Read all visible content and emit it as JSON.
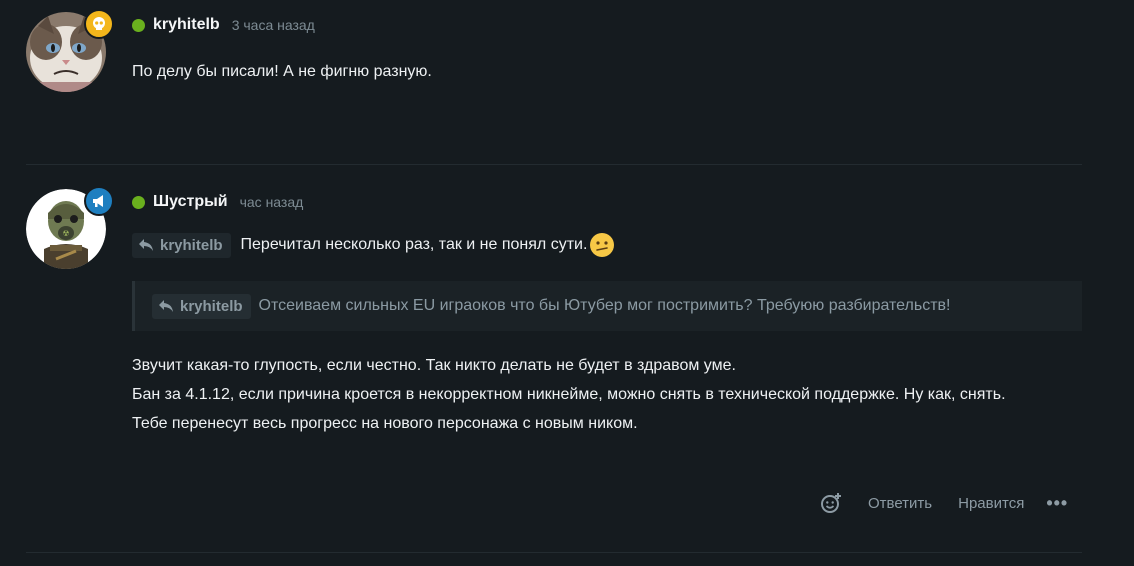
{
  "comments": [
    {
      "author": "kryhitelb",
      "time": "3 часа назад",
      "badge_icon": "skull-icon",
      "text": "По делу бы писали! А не фигню разную."
    },
    {
      "author": "Шустрый",
      "time": "час назад",
      "badge_icon": "megaphone-icon",
      "reply_to": "kryhitelb",
      "reply_text": "Перечитал несколько раз, так и не понял сути.",
      "quote": {
        "author": "kryhitelb",
        "text": "Отсеиваем сильных EU играоков что бы Ютубер мог постримить? Требуюю разбирательств!"
      },
      "body_lines": [
        "Звучит какая-то глупость, если честно. Так никто делать не будет в здравом уме.",
        "Бан за 4.1.12, если причина кроется в некорректном никнейме, можно снять в технической поддержке. Ну как, снять.",
        "Тебе перенесут весь прогресс на нового персонажа с новым ником."
      ],
      "actions": {
        "reply": "Ответить",
        "like": "Нравится"
      }
    }
  ],
  "colors": {
    "background": "#151b1f",
    "online": "#6ab01e",
    "badge_gold": "#f3b61b",
    "badge_blue": "#1e7fc0"
  }
}
